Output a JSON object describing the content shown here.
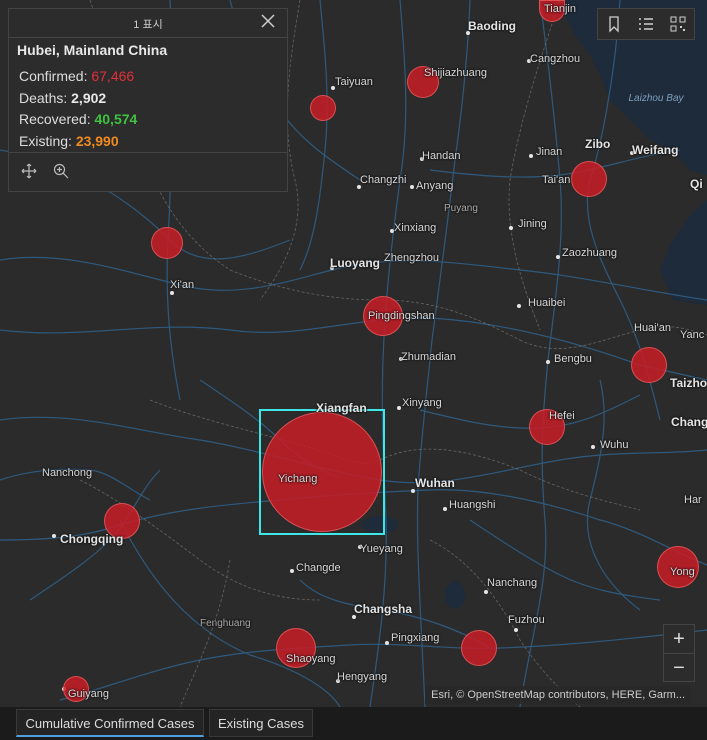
{
  "popup": {
    "count_label": "1 표시",
    "title": "Hubei, Mainland China",
    "rows": [
      {
        "label": "Confirmed:",
        "value": "67,466",
        "color": "#e0303a"
      },
      {
        "label": "Deaths:",
        "value": "2,902",
        "color": "#e8e8e8"
      },
      {
        "label": "Recovered:",
        "value": "40,574",
        "color": "#3fc23f"
      },
      {
        "label": "Existing:",
        "value": "23,990",
        "color": "#f08a20"
      }
    ]
  },
  "icons": {
    "close": "close-icon",
    "pan": "move-icon",
    "zoom_to": "zoom-in-icon",
    "bookmarks": "bookmark-icon",
    "legend": "legend-list-icon",
    "qr": "qr-code-icon"
  },
  "cities": {
    "tianjin": "Tianjin",
    "baoding": "Baoding",
    "cangzhou": "Cangzhou",
    "taiyuan": "Taiyuan",
    "shijiazhuang": "Shijiazhuang",
    "handan": "Handan",
    "jinan": "Jinan",
    "zibo": "Zibo",
    "weifang": "Weifang",
    "qi": "Qi",
    "changzhi": "Changzhi",
    "anyang": "Anyang",
    "taian": "Tai'an",
    "puyang": "Puyang",
    "xinxiang": "Xinxiang",
    "jining": "Jining",
    "xian": "Xi'an",
    "luoyang": "Luoyang",
    "zhengzhou": "Zhengzhou",
    "zaozhuang": "Zaozhuang",
    "huaibei": "Huaibei",
    "pingdingshan": "Pingdingshan",
    "huaian": "Huai'an",
    "yanc": "Yanc",
    "zhumadian": "Zhumadian",
    "bengbu": "Bengbu",
    "taizho": "Taizho",
    "xiangfan": "Xiangfan",
    "xinyang": "Xinyang",
    "hefei": "Hefei",
    "chang": "Chang",
    "wuhu": "Wuhu",
    "nanchong": "Nanchong",
    "yichang": "Yichang",
    "wuhan": "Wuhan",
    "huangshi": "Huangshi",
    "har": "Har",
    "chongqing": "Chongqing",
    "yueyang": "Yueyang",
    "changde": "Changde",
    "yong": "Yong",
    "nanchang": "Nanchang",
    "changsha": "Changsha",
    "fuzhou": "Fuzhou",
    "fenghuang": "Fenghuang",
    "pingxiang": "Pingxiang",
    "shaoyang": "Shaoyang",
    "hengyang": "Hengyang",
    "guiyang": "Guiyang"
  },
  "water": {
    "laizhou_bay": "Laizhou Bay"
  },
  "attribution": "Esri, © OpenStreetMap contributors, HERE, Garm...",
  "zoom": {
    "in": "+",
    "out": "−"
  },
  "tabs": [
    {
      "label": "Cumulative Confirmed Cases",
      "active": true
    },
    {
      "label": "Existing Cases",
      "active": false
    }
  ],
  "colors": {
    "bubble": "#c81c26",
    "selection": "#3ee6e6",
    "road": "#2f5f86",
    "water": "#1e2b3a"
  }
}
